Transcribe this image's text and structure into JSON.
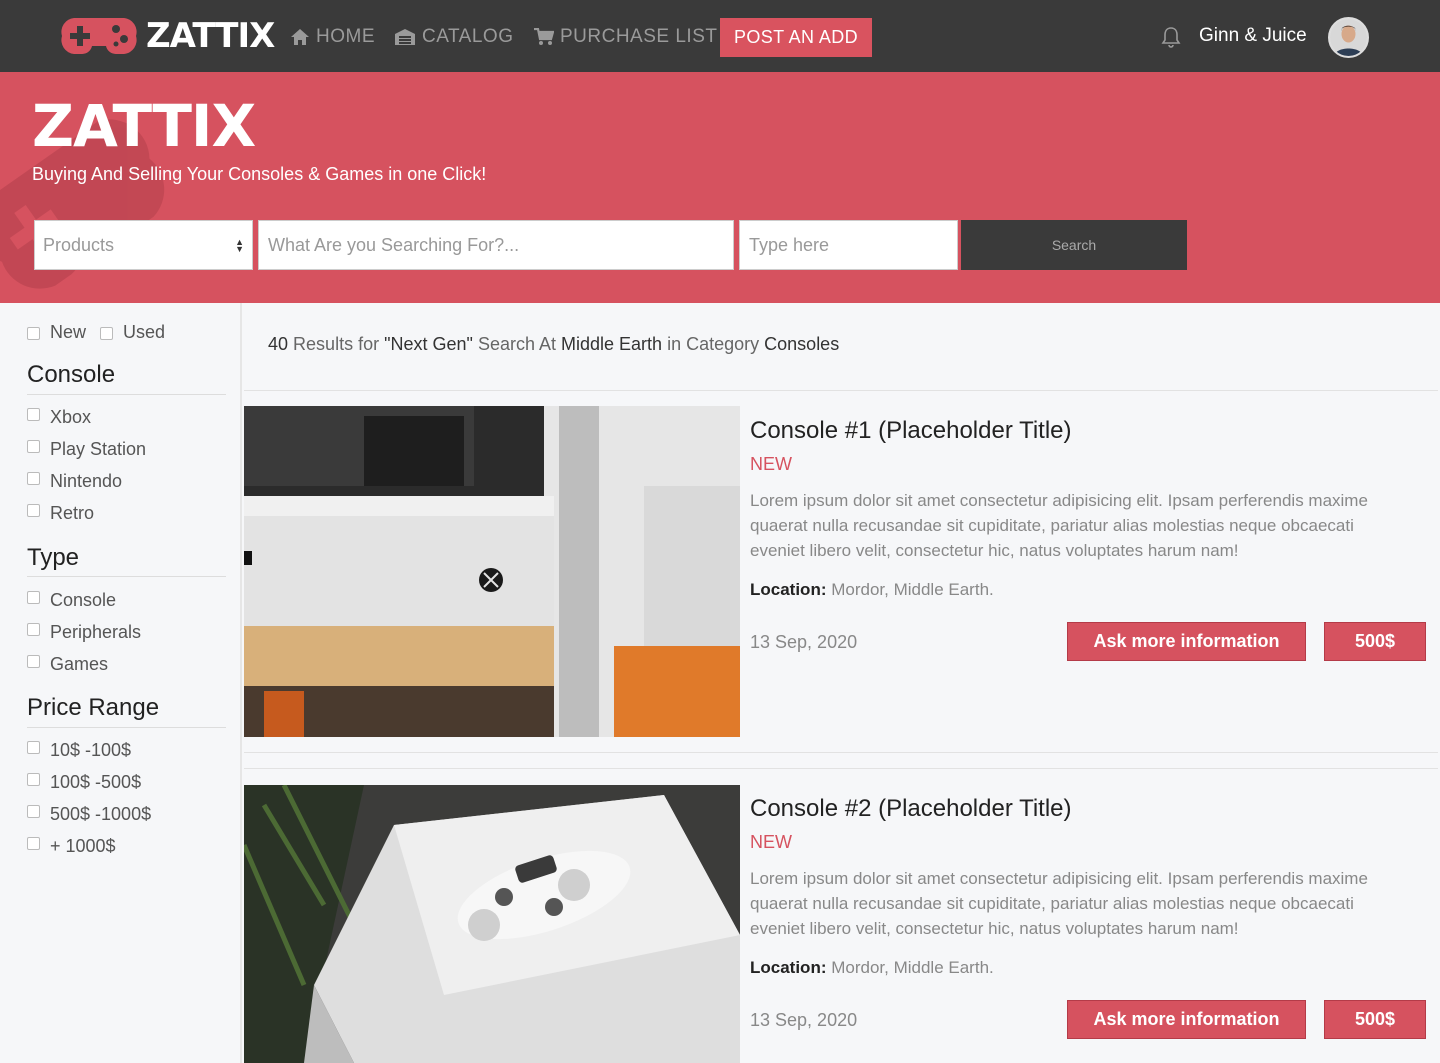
{
  "colors": {
    "accent": "#d6525f",
    "navbar": "#3a3a3a",
    "hero": "#d6525f"
  },
  "navbar": {
    "brand": "ZATTIX",
    "brand_icon": "gamepad-icon",
    "links": [
      {
        "label": "HOME",
        "icon": "home-icon"
      },
      {
        "label": "CATALOG",
        "icon": "garage-icon"
      },
      {
        "label": "PURCHASE LIST",
        "icon": "cart-icon"
      }
    ],
    "post_button": "POST AN ADD",
    "notification_icon": "bell-icon",
    "username": "Ginn & Juice"
  },
  "hero": {
    "title": "ZATTIX",
    "subtitle": "Buying And Selling Your Consoles & Games in one Click!",
    "select_value": "Products",
    "search_placeholder": "What Are you Searching For?...",
    "location_placeholder": "Type here",
    "search_button": "Search"
  },
  "sidebar": {
    "condition": [
      "New",
      "Used"
    ],
    "groups": [
      {
        "title": "Console",
        "items": [
          "Xbox",
          "Play Station",
          "Nintendo",
          "Retro"
        ]
      },
      {
        "title": "Type",
        "items": [
          "Console",
          "Peripherals",
          "Games"
        ]
      },
      {
        "title": "Price Range",
        "items": [
          "10$ -100$",
          "100$ -500$",
          "500$ -1000$",
          "+ 1000$"
        ]
      }
    ]
  },
  "results": {
    "count": "40",
    "results_for": "Results for",
    "query": "\"Next Gen\"",
    "search_at": "Search At",
    "location": "Middle Earth",
    "in_category": "in Category",
    "category": "Consoles"
  },
  "listings": [
    {
      "title": "Console #1 (Placeholder Title)",
      "badge": "NEW",
      "description": "Lorem ipsum dolor sit amet consectetur adipisicing elit. Ipsam perferendis maxime quaerat nulla recusandae sit cupiditate, pariatur alias molestias neque obcaecati eveniet libero velit, consectetur hic, natus voluptates harum nam!",
      "location_label": "Location:",
      "location": "Mordor, Middle Earth.",
      "date": "13 Sep, 2020",
      "info_button": "Ask more information",
      "price": "500$"
    },
    {
      "title": "Console #2 (Placeholder Title)",
      "badge": "NEW",
      "description": "Lorem ipsum dolor sit amet consectetur adipisicing elit. Ipsam perferendis maxime quaerat nulla recusandae sit cupiditate, pariatur alias molestias neque obcaecati eveniet libero velit, consectetur hic, natus voluptates harum nam!",
      "location_label": "Location:",
      "location": "Mordor, Middle Earth.",
      "date": "13 Sep, 2020",
      "info_button": "Ask more information",
      "price": "500$"
    }
  ]
}
